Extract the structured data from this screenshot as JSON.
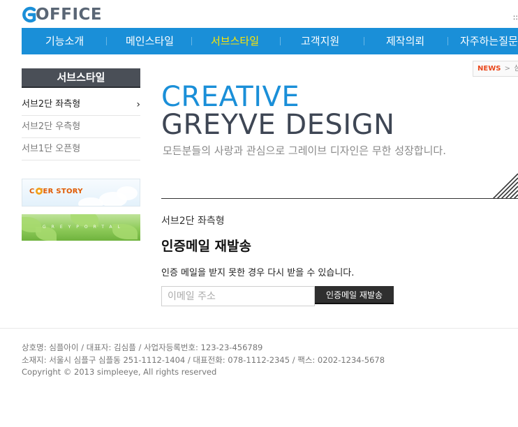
{
  "header": {
    "logo_text": "OFFICE",
    "top_right_text": "::"
  },
  "nav": {
    "items": [
      {
        "label": "기능소개"
      },
      {
        "label": "메인스타일"
      },
      {
        "label": "서브스타일"
      },
      {
        "label": "고객지원"
      },
      {
        "label": "제작의뢰"
      },
      {
        "label": "자주하는질문"
      }
    ],
    "active_index": 2
  },
  "sidebar": {
    "title": "서브스타일",
    "items": [
      {
        "label": "서브2단 좌측형",
        "arrow": "›"
      },
      {
        "label": "서브2단 우측형"
      },
      {
        "label": "서브1단 오픈형"
      }
    ],
    "banner_cover": "C   VER STORY",
    "banner_grey": "GREYPORTAL"
  },
  "location": {
    "news": "NEWS",
    "separator": ">",
    "current": "심플"
  },
  "visual": {
    "line1": "CREATIVE",
    "line2": "GREYVE DESIGN",
    "subtitle": "모든분들의 사랑과 관심으로 그레이브 디자인은 무한 성장합니다."
  },
  "content": {
    "subtitle": "서브2단 좌측형",
    "heading": "인증메일 재발송",
    "description": "인증 메일을 받지 못한 경우 다시 받을 수 있습니다.",
    "email_placeholder": "이메일 주소",
    "button_label": "인증메일 재발송"
  },
  "footer": {
    "line1": "상호명: 심플아이 / 대표자: 김심플 / 사업자등록번호: 123-23-456789",
    "line2": "소재지: 서울시 심플구 심플동 251-1112-1404 / 대표전화: 078-1112-2345 / 팩스: 0202-1234-5678",
    "line3": "Copyright © 2013 simpleeye, All rights reserved"
  },
  "colors": {
    "brand_blue": "#1a8fd8",
    "nav_active": "#ffe600",
    "sidebar_title_bg": "#4a4f57",
    "news_red": "#e9471b"
  }
}
